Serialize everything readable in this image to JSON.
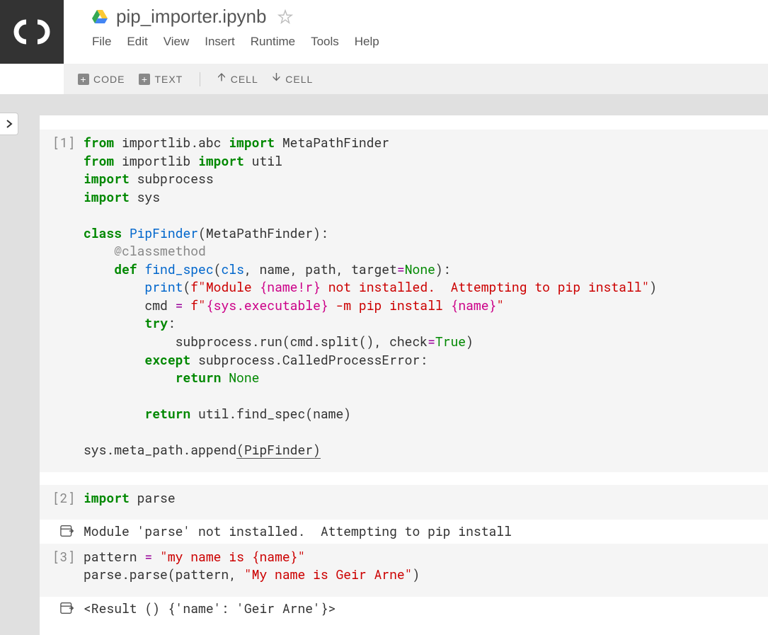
{
  "title": "pip_importer.ipynb",
  "menus": [
    "File",
    "Edit",
    "View",
    "Insert",
    "Runtime",
    "Tools",
    "Help"
  ],
  "toolbar": {
    "code": "CODE",
    "text": "TEXT",
    "cell1": "CELL",
    "cell2": "CELL"
  },
  "cells": [
    {
      "prompt": "[1]",
      "type": "code",
      "html": "<span class=\"kw\">from</span> importlib.abc <span class=\"kw\">import</span> MetaPathFinder\n<span class=\"kw\">from</span> importlib <span class=\"kw\">import</span> util\n<span class=\"kw\">import</span> subprocess\n<span class=\"kw\">import</span> sys\n\n<span class=\"kw\">class</span> <span class=\"cls\">PipFinder</span>(MetaPathFinder):\n    <span class=\"dec\">@classmethod</span>\n    <span class=\"kw\">def</span> <span class=\"cls\">find_spec</span>(<span class=\"fn\">cls</span>, name, path, target<span class=\"op\">=</span><span class=\"lit\">None</span>):\n        <span class=\"fn\">print</span>(<span class=\"str\">f\"Module </span><span class=\"str2\">{name!r}</span><span class=\"str\"> not installed.  Attempting to pip install\"</span>)\n        cmd <span class=\"op\">=</span> <span class=\"str\">f\"</span><span class=\"str2\">{sys.executable}</span><span class=\"str\"> -m pip install </span><span class=\"str2\">{name}</span><span class=\"str\">\"</span>\n        <span class=\"kw\">try</span>:\n            subprocess.run(cmd.split(), check<span class=\"op\">=</span><span class=\"lit\">True</span>)\n        <span class=\"kw\">except</span> subprocess.CalledProcessError:\n            <span class=\"kw\">return</span> <span class=\"lit\">None</span>\n\n        <span class=\"kw\">return</span> util.find_spec(name)\n\nsys.meta_path.append<span style=\"border-bottom:1px solid #555\">(PipFinder)</span>"
    },
    {
      "prompt": "[2]",
      "type": "code",
      "html": "<span class=\"kw\">import</span> parse"
    },
    {
      "type": "output",
      "text": "Module 'parse' not installed.  Attempting to pip install"
    },
    {
      "prompt": "[3]",
      "type": "code",
      "html": "pattern <span class=\"op\">=</span> <span class=\"str\">\"my name is {name}\"</span>\nparse.parse(pattern, <span class=\"str\">\"My name is Geir Arne\"</span>)"
    },
    {
      "type": "output",
      "text": "<Result () {'name': 'Geir Arne'}>"
    }
  ]
}
